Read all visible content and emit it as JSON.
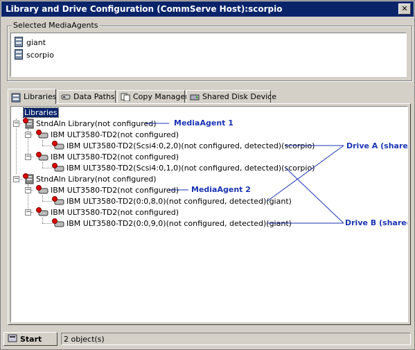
{
  "window": {
    "title": "Library and Drive Configuration (CommServe Host):scorpio",
    "close_label": "✕"
  },
  "media_agents": {
    "legend": "Selected MediaAgents",
    "items": [
      {
        "label": "giant"
      },
      {
        "label": "scorpio"
      }
    ]
  },
  "tabs": [
    {
      "label": "Libraries",
      "icon": "libraries-icon"
    },
    {
      "label": "Data Paths",
      "icon": "data-paths-icon"
    },
    {
      "label": "Copy Manager",
      "icon": "copy-manager-icon"
    },
    {
      "label": "Shared Disk Device",
      "icon": "shared-disk-icon"
    }
  ],
  "tree": {
    "root": "Libraries",
    "lib1": "StndAln Library(not configured)",
    "lib1_drv1": "IBM ULT3580-TD2(not configured)",
    "lib1_drv1_dev": "IBM ULT3580-TD2(Scsi4:0,2,0)(not configured, detected)(scorpio)",
    "lib1_drv2": "IBM ULT3580-TD2(not configured)",
    "lib1_drv2_dev": "IBM ULT3580-TD2(Scsi4:0,1,0)(not configured, detected)(scorpio)",
    "lib2": "StndAln Library(not configured)",
    "lib2_drv1": "IBM ULT3580-TD2(not configured)",
    "lib2_drv1_dev": "IBM ULT3580-TD2(0:0,8,0)(not configured, detected)(giant)",
    "lib2_drv2": "IBM ULT3580-TD2(not configured)",
    "lib2_drv2_dev": "IBM ULT3580-TD2(0:0,9,0)(not configured, detected)(giant)"
  },
  "annotations": {
    "mediaagent1": "MediaAgent 1",
    "mediaagent2": "MediaAgent 2",
    "drive_a": "Drive A (shared)",
    "drive_b": "Drive B (shared)",
    "color": "#1a33b3"
  },
  "status": {
    "start_label": "Start",
    "count": "2 object(s)"
  },
  "colors": {
    "titlebar": "#0a246a",
    "error": "#dd0000",
    "panel": "#d4d0c8"
  }
}
